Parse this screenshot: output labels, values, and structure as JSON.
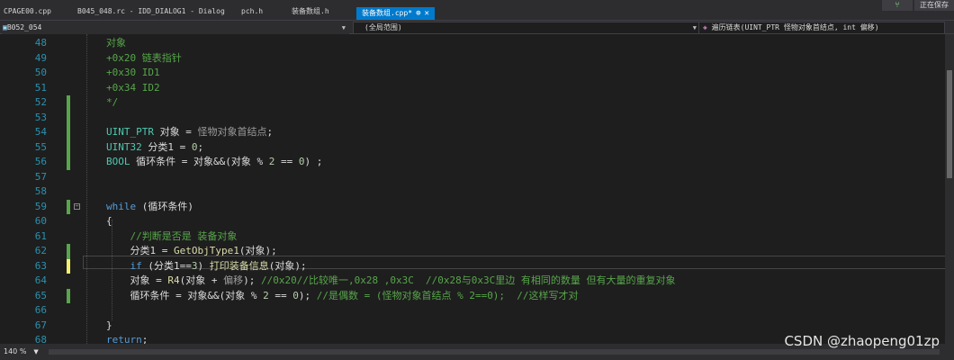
{
  "tabs": [
    {
      "label": "CPAGE00.cpp"
    },
    {
      "label": "B045_048.rc - IDD_DIALOG1 - Dialog"
    },
    {
      "label": "pch.h"
    },
    {
      "label": "装备数组.h"
    },
    {
      "label": "装备数组.cpp*",
      "active": true
    }
  ],
  "tab_icons": {
    "pin": "⊕",
    "close": "✕"
  },
  "top_right": {
    "icon": "git-icon",
    "label": "正在保存"
  },
  "nav": {
    "project": "B052_054",
    "scope": "(全局范围)",
    "function": "遍历链表(UINT_PTR 怪物对象首结点, int 偏移)"
  },
  "lines": [
    {
      "num": "48",
      "parts": [
        {
          "t": "对象",
          "c": "comment"
        }
      ]
    },
    {
      "num": "49",
      "parts": [
        {
          "t": "+0x20 链表指针",
          "c": "comment"
        }
      ]
    },
    {
      "num": "50",
      "parts": [
        {
          "t": "+0x30 ID1",
          "c": "comment"
        }
      ]
    },
    {
      "num": "51",
      "parts": [
        {
          "t": "+0x34 ID2",
          "c": "comment"
        }
      ]
    },
    {
      "num": "52",
      "mark": true,
      "parts": [
        {
          "t": "*/",
          "c": "comment"
        }
      ]
    },
    {
      "num": "53",
      "mark": true,
      "parts": []
    },
    {
      "num": "54",
      "mark": true,
      "parts": [
        {
          "t": "UINT_PTR ",
          "c": "type"
        },
        {
          "t": "对象 = ",
          "c": "var"
        },
        {
          "t": "怪物对象首结点",
          "c": "grey"
        },
        {
          "t": ";",
          "c": "var"
        }
      ]
    },
    {
      "num": "55",
      "mark": true,
      "parts": [
        {
          "t": "UINT32 ",
          "c": "type"
        },
        {
          "t": "分类1 = ",
          "c": "var"
        },
        {
          "t": "0",
          "c": "num"
        },
        {
          "t": ";",
          "c": "var"
        }
      ]
    },
    {
      "num": "56",
      "mark": true,
      "parts": [
        {
          "t": "BOOL ",
          "c": "type"
        },
        {
          "t": "循环条件 = 对象&&(对象 % ",
          "c": "var"
        },
        {
          "t": "2",
          "c": "num"
        },
        {
          "t": " == ",
          "c": "var"
        },
        {
          "t": "0",
          "c": "num"
        },
        {
          "t": ") ;",
          "c": "var"
        }
      ]
    },
    {
      "num": "57",
      "parts": []
    },
    {
      "num": "58",
      "parts": []
    },
    {
      "num": "59",
      "mark": true,
      "fold": true,
      "parts": [
        {
          "t": "while",
          "c": "kw"
        },
        {
          "t": " (循环条件)",
          "c": "var"
        }
      ]
    },
    {
      "num": "60",
      "parts": [
        {
          "t": "{",
          "c": "var"
        }
      ]
    },
    {
      "num": "61",
      "parts": [
        {
          "t": "    //判断是否是 装备对象",
          "c": "comment"
        }
      ]
    },
    {
      "num": "62",
      "mark": true,
      "parts": [
        {
          "t": "    分类1 = ",
          "c": "var"
        },
        {
          "t": "GetObjType1",
          "c": "fn"
        },
        {
          "t": "(对象);",
          "c": "var"
        }
      ]
    },
    {
      "num": "63",
      "mark": true,
      "current": true,
      "parts": [
        {
          "t": "    ",
          "c": "var"
        },
        {
          "t": "if",
          "c": "kw"
        },
        {
          "t": " (分类1==",
          "c": "var"
        },
        {
          "t": "3",
          "c": "num"
        },
        {
          "t": ") ",
          "c": "var"
        },
        {
          "t": "打印装备信息",
          "c": "fn"
        },
        {
          "t": "(对象);",
          "c": "var"
        }
      ]
    },
    {
      "num": "64",
      "parts": [
        {
          "t": "    对象 = ",
          "c": "var"
        },
        {
          "t": "R4",
          "c": "fn"
        },
        {
          "t": "(对象 + ",
          "c": "var"
        },
        {
          "t": "偏移",
          "c": "grey"
        },
        {
          "t": "); ",
          "c": "var"
        },
        {
          "t": "//0x20//比较唯一,0x28 ,0x3C  //0x28与0x3C里边 有相同的数量 但有大量的重复对象",
          "c": "comment"
        }
      ]
    },
    {
      "num": "65",
      "mark": true,
      "parts": [
        {
          "t": "    循环条件 = 对象&&(对象 % ",
          "c": "var"
        },
        {
          "t": "2",
          "c": "num"
        },
        {
          "t": " == ",
          "c": "var"
        },
        {
          "t": "0",
          "c": "num"
        },
        {
          "t": "); ",
          "c": "var"
        },
        {
          "t": "//是偶数 = (怪物对象首结点 % 2==0);  //这样写才对",
          "c": "comment"
        }
      ]
    },
    {
      "num": "66",
      "parts": []
    },
    {
      "num": "67",
      "parts": [
        {
          "t": "}",
          "c": "var"
        }
      ]
    },
    {
      "num": "68",
      "parts": [
        {
          "t": "return",
          "c": "kw"
        },
        {
          "t": ";",
          "c": "var"
        }
      ]
    }
  ],
  "zoom": "140 %",
  "watermark": "CSDN @zhaopeng01zp"
}
